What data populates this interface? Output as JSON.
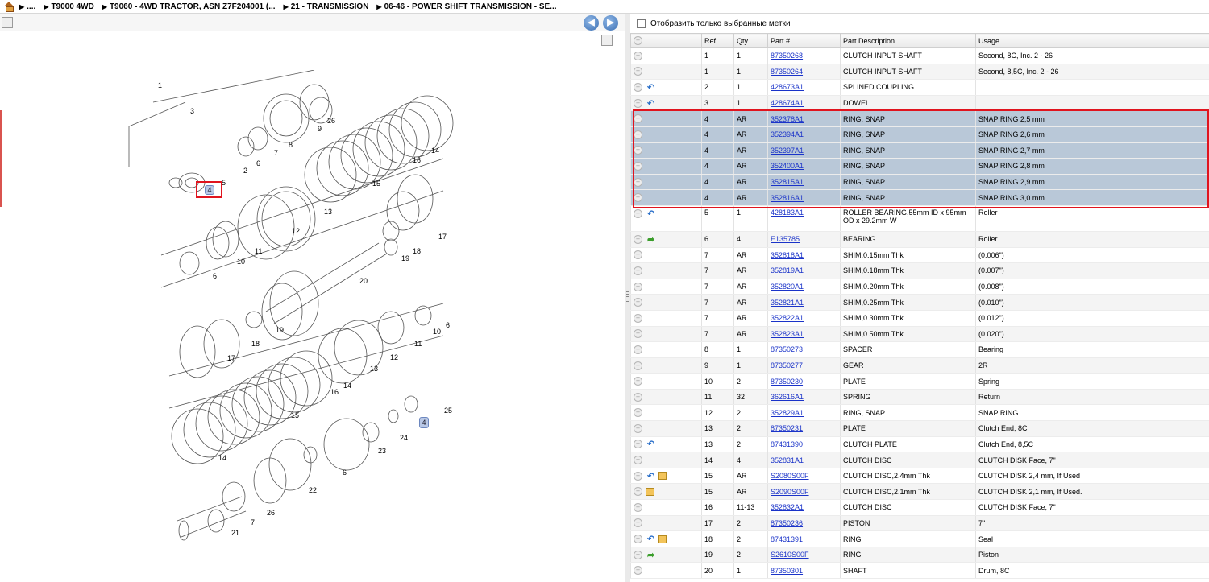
{
  "breadcrumb": {
    "items": [
      "....",
      "T9000 4WD",
      "T9060 - 4WD TRACTOR, ASN Z7F204001 (...",
      "21 - TRANSMISSION",
      "06-46 - POWER SHIFT TRANSMISSION - SE..."
    ]
  },
  "filter": {
    "label": "Отобразить только выбранные метки"
  },
  "table": {
    "headers": [
      "Ref",
      "Qty",
      "Part #",
      "Part Description",
      "Usage"
    ],
    "rows": [
      {
        "icons": [],
        "ref": "1",
        "qty": "1",
        "part": "87350268",
        "desc": "CLUTCH INPUT SHAFT",
        "usage": "Second, 8C, Inc. 2 - 26"
      },
      {
        "icons": [],
        "ref": "1",
        "qty": "1",
        "part": "87350264",
        "desc": "CLUTCH INPUT SHAFT",
        "usage": "Second, 8,5C, Inc. 2 - 26"
      },
      {
        "icons": [
          "back"
        ],
        "ref": "2",
        "qty": "1",
        "part": "428673A1",
        "desc": "SPLINED COUPLING",
        "usage": ""
      },
      {
        "icons": [
          "back"
        ],
        "ref": "3",
        "qty": "1",
        "part": "428674A1",
        "desc": "DOWEL",
        "usage": ""
      },
      {
        "icons": [],
        "ref": "4",
        "qty": "AR",
        "part": "352378A1",
        "desc": "RING, SNAP",
        "usage": "SNAP RING 2,5 mm",
        "sel": true
      },
      {
        "icons": [],
        "ref": "4",
        "qty": "AR",
        "part": "352394A1",
        "desc": "RING, SNAP",
        "usage": "SNAP RING 2,6 mm",
        "sel": true
      },
      {
        "icons": [],
        "ref": "4",
        "qty": "AR",
        "part": "352397A1",
        "desc": "RING, SNAP",
        "usage": "SNAP RING 2,7 mm",
        "sel": true
      },
      {
        "icons": [],
        "ref": "4",
        "qty": "AR",
        "part": "352400A1",
        "desc": "RING, SNAP",
        "usage": "SNAP RING 2,8 mm",
        "sel": true
      },
      {
        "icons": [],
        "ref": "4",
        "qty": "AR",
        "part": "352815A1",
        "desc": "RING, SNAP",
        "usage": "SNAP RING 2,9 mm",
        "sel": true
      },
      {
        "icons": [],
        "ref": "4",
        "qty": "AR",
        "part": "352816A1",
        "desc": "RING, SNAP",
        "usage": "SNAP RING 3,0 mm",
        "sel": true
      },
      {
        "icons": [
          "back"
        ],
        "ref": "5",
        "qty": "1",
        "part": "428183A1",
        "desc": "ROLLER BEARING,55mm ID x 95mm OD x 29.2mm W",
        "usage": "Roller",
        "tall": true
      },
      {
        "icons": [
          "fwd"
        ],
        "ref": "6",
        "qty": "4",
        "part": "E135785",
        "desc": "BEARING",
        "usage": "Roller"
      },
      {
        "icons": [],
        "ref": "7",
        "qty": "AR",
        "part": "352818A1",
        "desc": "SHIM,0.15mm Thk",
        "usage": "(0.006\")"
      },
      {
        "icons": [],
        "ref": "7",
        "qty": "AR",
        "part": "352819A1",
        "desc": "SHIM,0.18mm Thk",
        "usage": "(0.007\")"
      },
      {
        "icons": [],
        "ref": "7",
        "qty": "AR",
        "part": "352820A1",
        "desc": "SHIM,0.20mm Thk",
        "usage": "(0.008\")"
      },
      {
        "icons": [],
        "ref": "7",
        "qty": "AR",
        "part": "352821A1",
        "desc": "SHIM,0.25mm Thk",
        "usage": "(0.010\")"
      },
      {
        "icons": [],
        "ref": "7",
        "qty": "AR",
        "part": "352822A1",
        "desc": "SHIM,0.30mm Thk",
        "usage": "(0.012\")"
      },
      {
        "icons": [],
        "ref": "7",
        "qty": "AR",
        "part": "352823A1",
        "desc": "SHIM,0.50mm Thk",
        "usage": "(0.020\")"
      },
      {
        "icons": [],
        "ref": "8",
        "qty": "1",
        "part": "87350273",
        "desc": "SPACER",
        "usage": "Bearing"
      },
      {
        "icons": [],
        "ref": "9",
        "qty": "1",
        "part": "87350277",
        "desc": "GEAR",
        "usage": "2R"
      },
      {
        "icons": [],
        "ref": "10",
        "qty": "2",
        "part": "87350230",
        "desc": "PLATE",
        "usage": "Spring"
      },
      {
        "icons": [],
        "ref": "11",
        "qty": "32",
        "part": "362616A1",
        "desc": "SPRING",
        "usage": "Return"
      },
      {
        "icons": [],
        "ref": "12",
        "qty": "2",
        "part": "352829A1",
        "desc": "RING, SNAP",
        "usage": "SNAP RING"
      },
      {
        "icons": [],
        "ref": "13",
        "qty": "2",
        "part": "87350231",
        "desc": "PLATE",
        "usage": "Clutch End, 8C"
      },
      {
        "icons": [
          "back"
        ],
        "ref": "13",
        "qty": "2",
        "part": "87431390",
        "desc": "CLUTCH PLATE",
        "usage": "Clutch End, 8,5C"
      },
      {
        "icons": [],
        "ref": "14",
        "qty": "4",
        "part": "352831A1",
        "desc": "CLUTCH DISC",
        "usage": "CLUTCH DISK Face, 7\""
      },
      {
        "icons": [
          "back",
          "box"
        ],
        "ref": "15",
        "qty": "AR",
        "part": "S2080S00F",
        "desc": "CLUTCH DISC,2.4mm Thk",
        "usage": "CLUTCH DISK 2,4 mm, If Used"
      },
      {
        "icons": [
          "box"
        ],
        "ref": "15",
        "qty": "AR",
        "part": "S2090S00F",
        "desc": "CLUTCH DISC,2.1mm Thk",
        "usage": "CLUTCH DISK 2,1 mm, If Used."
      },
      {
        "icons": [],
        "ref": "16",
        "qty": "11-13",
        "part": "352832A1",
        "desc": "CLUTCH DISC",
        "usage": "CLUTCH DISK Face, 7\""
      },
      {
        "icons": [],
        "ref": "17",
        "qty": "2",
        "part": "87350236",
        "desc": "PISTON",
        "usage": "7\""
      },
      {
        "icons": [
          "back",
          "box"
        ],
        "ref": "18",
        "qty": "2",
        "part": "87431391",
        "desc": "RING",
        "usage": "Seal"
      },
      {
        "icons": [
          "fwd"
        ],
        "ref": "19",
        "qty": "2",
        "part": "S2610S00F",
        "desc": "RING",
        "usage": "Piston"
      },
      {
        "icons": [],
        "ref": "20",
        "qty": "1",
        "part": "87350301",
        "desc": "SHAFT",
        "usage": "Drum, 8C"
      }
    ]
  },
  "diagram": {
    "callouts": [
      "1",
      "3",
      "2",
      "5",
      "6",
      "7",
      "8",
      "9",
      "26",
      "14",
      "16",
      "15",
      "13",
      "12",
      "11",
      "10",
      "6",
      "17",
      "18",
      "19",
      "20",
      "19",
      "18",
      "17",
      "6",
      "10",
      "11",
      "12",
      "13",
      "14",
      "16",
      "15",
      "14",
      "25",
      "24",
      "23",
      "22",
      "26",
      "21",
      "7",
      "6"
    ],
    "highlight_label": "4"
  },
  "colors": {
    "selected_row": "#b9c8d8",
    "highlight_box": "#e0141e",
    "link": "#1a33c9"
  }
}
